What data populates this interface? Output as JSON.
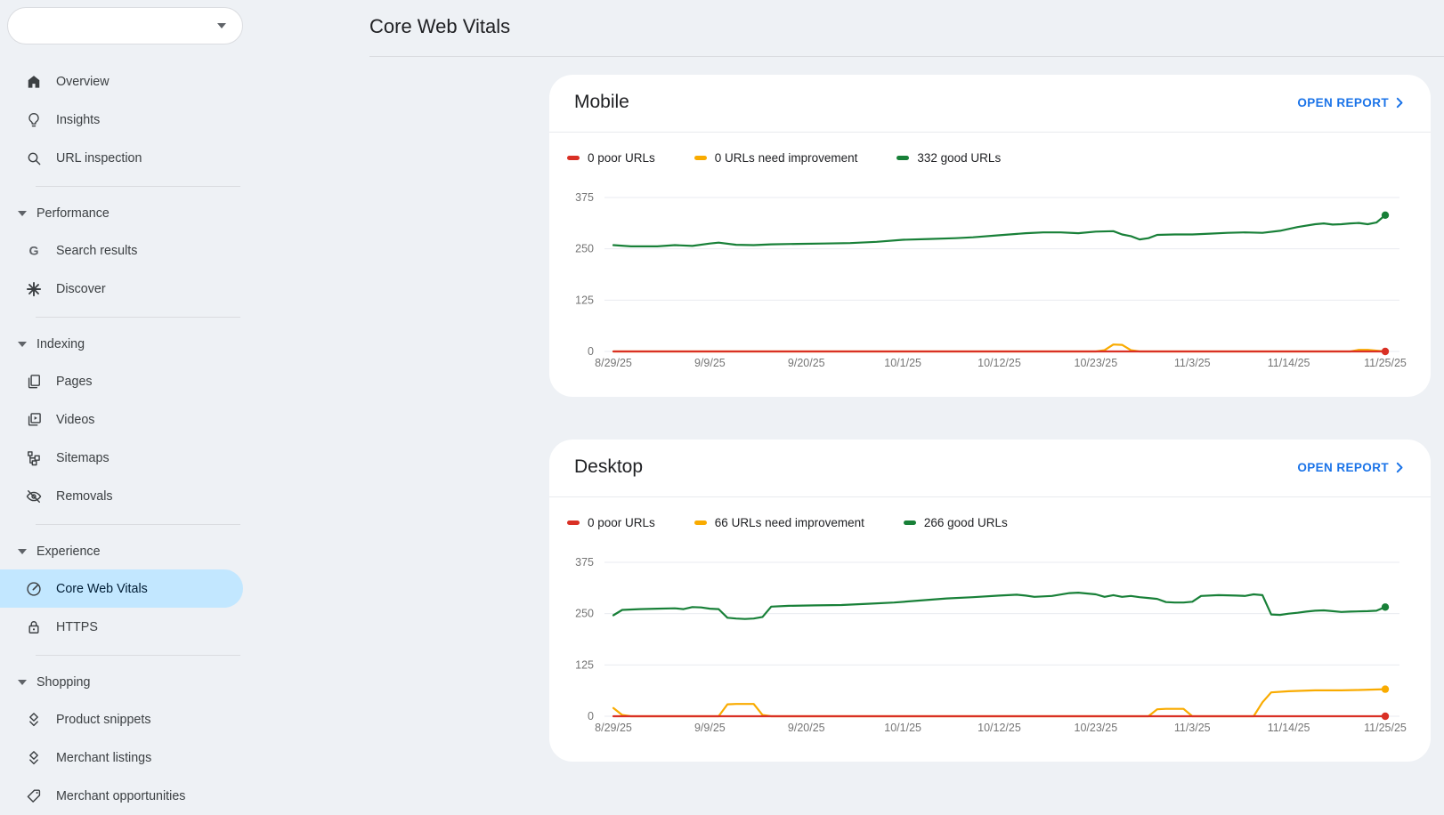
{
  "header": {
    "title": "Core Web Vitals"
  },
  "colors": {
    "poor": "#d93025",
    "needs_improvement": "#f9ab00",
    "good": "#188038",
    "link": "#1a73e8",
    "selected_bg": "#c2e7ff",
    "page_bg": "#eef1f5"
  },
  "sidebar": {
    "property_selector": {
      "value": "",
      "icon": "chevron-down-icon"
    },
    "top_items": [
      {
        "label": "Overview",
        "icon": "home-icon"
      },
      {
        "label": "Insights",
        "icon": "lightbulb-icon"
      },
      {
        "label": "URL inspection",
        "icon": "search-icon"
      }
    ],
    "sections": [
      {
        "label": "Performance",
        "icon": "arrow-drop-down-icon",
        "items": [
          {
            "label": "Search results",
            "icon": "google-g-icon"
          },
          {
            "label": "Discover",
            "icon": "asterisk-icon"
          }
        ]
      },
      {
        "label": "Indexing",
        "icon": "arrow-drop-down-icon",
        "items": [
          {
            "label": "Pages",
            "icon": "pages-icon"
          },
          {
            "label": "Videos",
            "icon": "videos-icon"
          },
          {
            "label": "Sitemaps",
            "icon": "sitemap-icon"
          },
          {
            "label": "Removals",
            "icon": "eye-off-icon"
          }
        ]
      },
      {
        "label": "Experience",
        "icon": "arrow-drop-down-icon",
        "items": [
          {
            "label": "Core Web Vitals",
            "icon": "speedometer-icon",
            "selected": true
          },
          {
            "label": "HTTPS",
            "icon": "lock-icon"
          }
        ]
      },
      {
        "label": "Shopping",
        "icon": "arrow-drop-down-icon",
        "items": [
          {
            "label": "Product snippets",
            "icon": "layers-icon"
          },
          {
            "label": "Merchant listings",
            "icon": "layers-icon"
          },
          {
            "label": "Merchant opportunities",
            "icon": "tag-icon"
          }
        ]
      }
    ]
  },
  "cards": [
    {
      "title": "Mobile",
      "open_report_label": "OPEN REPORT",
      "legend": [
        {
          "label": "0 poor URLs",
          "color": "#d93025"
        },
        {
          "label": "0 URLs need improvement",
          "color": "#f9ab00"
        },
        {
          "label": "332 good URLs",
          "color": "#188038"
        }
      ]
    },
    {
      "title": "Desktop",
      "open_report_label": "OPEN REPORT",
      "legend": [
        {
          "label": "0 poor URLs",
          "color": "#d93025"
        },
        {
          "label": "66 URLs need improvement",
          "color": "#f9ab00"
        },
        {
          "label": "266 good URLs",
          "color": "#188038"
        }
      ]
    }
  ],
  "chart_data": [
    {
      "type": "line",
      "title": "Mobile",
      "ylim": [
        0,
        375
      ],
      "yticks": [
        0,
        125,
        250,
        375
      ],
      "x_tick_labels": [
        "8/29/25",
        "9/9/25",
        "9/20/25",
        "10/1/25",
        "10/12/25",
        "10/23/25",
        "11/3/25",
        "11/14/25",
        "11/25/25"
      ],
      "x_range_days": [
        0,
        88
      ],
      "grid": true,
      "series": [
        {
          "name": "good URLs",
          "color": "#188038",
          "end_dot": true,
          "points": [
            [
              0,
              259
            ],
            [
              2,
              256
            ],
            [
              5,
              256
            ],
            [
              7,
              259
            ],
            [
              9,
              257
            ],
            [
              11,
              263
            ],
            [
              12,
              265
            ],
            [
              14,
              260
            ],
            [
              16,
              259
            ],
            [
              18,
              261
            ],
            [
              21,
              262
            ],
            [
              24,
              263
            ],
            [
              27,
              264
            ],
            [
              30,
              267
            ],
            [
              33,
              272
            ],
            [
              36,
              274
            ],
            [
              39,
              276
            ],
            [
              41,
              278
            ],
            [
              44,
              283
            ],
            [
              47,
              288
            ],
            [
              49,
              290
            ],
            [
              51,
              290
            ],
            [
              53,
              288
            ],
            [
              55,
              292
            ],
            [
              57,
              293
            ],
            [
              58,
              285
            ],
            [
              59,
              281
            ],
            [
              60,
              273
            ],
            [
              61,
              276
            ],
            [
              62,
              284
            ],
            [
              64,
              285
            ],
            [
              66,
              285
            ],
            [
              68,
              287
            ],
            [
              70,
              289
            ],
            [
              72,
              290
            ],
            [
              74,
              289
            ],
            [
              76,
              294
            ],
            [
              78,
              303
            ],
            [
              80,
              310
            ],
            [
              81,
              312
            ],
            [
              82,
              309
            ],
            [
              83,
              310
            ],
            [
              84,
              312
            ],
            [
              85,
              313
            ],
            [
              86,
              310
            ],
            [
              87,
              314
            ],
            [
              88,
              332
            ]
          ]
        },
        {
          "name": "URLs need improvement",
          "color": "#f9ab00",
          "end_dot": false,
          "points": [
            [
              0,
              0
            ],
            [
              55,
              0
            ],
            [
              56,
              3
            ],
            [
              57,
              17
            ],
            [
              58,
              16
            ],
            [
              59,
              3
            ],
            [
              60,
              0
            ],
            [
              84,
              0
            ],
            [
              85,
              4
            ],
            [
              86,
              4
            ],
            [
              87,
              2
            ],
            [
              88,
              0
            ]
          ]
        },
        {
          "name": "poor URLs",
          "color": "#d93025",
          "end_dot": true,
          "points": [
            [
              0,
              0
            ],
            [
              88,
              0
            ]
          ]
        }
      ]
    },
    {
      "type": "line",
      "title": "Desktop",
      "ylim": [
        0,
        375
      ],
      "yticks": [
        0,
        125,
        250,
        375
      ],
      "x_tick_labels": [
        "8/29/25",
        "9/9/25",
        "9/20/25",
        "10/1/25",
        "10/12/25",
        "10/23/25",
        "11/3/25",
        "11/14/25",
        "11/25/25"
      ],
      "x_range_days": [
        0,
        88
      ],
      "grid": true,
      "series": [
        {
          "name": "good URLs",
          "color": "#188038",
          "end_dot": true,
          "points": [
            [
              0,
              246
            ],
            [
              1,
              259
            ],
            [
              3,
              261
            ],
            [
              5,
              262
            ],
            [
              7,
              263
            ],
            [
              8,
              261
            ],
            [
              9,
              266
            ],
            [
              10,
              265
            ],
            [
              11,
              262
            ],
            [
              12,
              261
            ],
            [
              13,
              240
            ],
            [
              14,
              238
            ],
            [
              15,
              237
            ],
            [
              16,
              238
            ],
            [
              17,
              242
            ],
            [
              18,
              267
            ],
            [
              20,
              269
            ],
            [
              23,
              270
            ],
            [
              26,
              271
            ],
            [
              29,
              274
            ],
            [
              32,
              277
            ],
            [
              35,
              282
            ],
            [
              38,
              287
            ],
            [
              41,
              290
            ],
            [
              44,
              294
            ],
            [
              46,
              296
            ],
            [
              47,
              294
            ],
            [
              48,
              291
            ],
            [
              50,
              293
            ],
            [
              52,
              300
            ],
            [
              53,
              301
            ],
            [
              55,
              297
            ],
            [
              56,
              291
            ],
            [
              57,
              295
            ],
            [
              58,
              291
            ],
            [
              59,
              293
            ],
            [
              60,
              290
            ],
            [
              61,
              288
            ],
            [
              62,
              286
            ],
            [
              63,
              278
            ],
            [
              64,
              277
            ],
            [
              65,
              277
            ],
            [
              66,
              279
            ],
            [
              67,
              293
            ],
            [
              69,
              295
            ],
            [
              71,
              294
            ],
            [
              72,
              293
            ],
            [
              73,
              297
            ],
            [
              74,
              295
            ],
            [
              75,
              248
            ],
            [
              76,
              247
            ],
            [
              77,
              250
            ],
            [
              78,
              252
            ],
            [
              79,
              255
            ],
            [
              80,
              257
            ],
            [
              81,
              258
            ],
            [
              82,
              256
            ],
            [
              83,
              254
            ],
            [
              84,
              255
            ],
            [
              86,
              256
            ],
            [
              87,
              257
            ],
            [
              88,
              266
            ]
          ]
        },
        {
          "name": "URLs need improvement",
          "color": "#f9ab00",
          "end_dot": true,
          "points": [
            [
              0,
              20
            ],
            [
              1,
              3
            ],
            [
              2,
              0
            ],
            [
              12,
              0
            ],
            [
              13,
              29
            ],
            [
              14,
              30
            ],
            [
              16,
              30
            ],
            [
              17,
              3
            ],
            [
              18,
              0
            ],
            [
              61,
              0
            ],
            [
              62,
              17
            ],
            [
              63,
              18
            ],
            [
              65,
              18
            ],
            [
              66,
              0
            ],
            [
              73,
              0
            ],
            [
              74,
              34
            ],
            [
              75,
              58
            ],
            [
              77,
              61
            ],
            [
              80,
              63
            ],
            [
              83,
              63
            ],
            [
              85,
              64
            ],
            [
              88,
              66
            ]
          ]
        },
        {
          "name": "poor URLs",
          "color": "#d93025",
          "end_dot": true,
          "points": [
            [
              0,
              0
            ],
            [
              88,
              0
            ]
          ]
        }
      ]
    }
  ]
}
